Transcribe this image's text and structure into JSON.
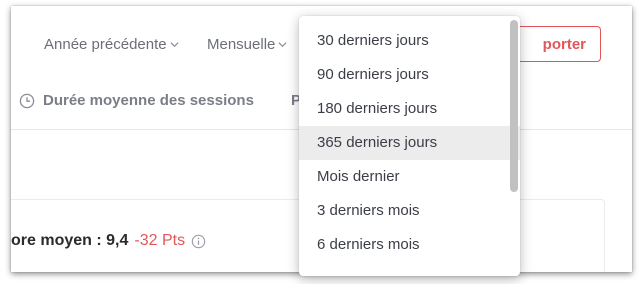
{
  "toolbar": {
    "period_filter": "Année précédente",
    "granularity_filter": "Mensuelle",
    "export_button_label": "porter"
  },
  "metrics_tabs": {
    "session_duration_label": "Durée moyenne des sessions",
    "more_label": "Plu"
  },
  "summary": {
    "score_label": "ore moyen : 9,4",
    "score_delta": "-32 Pts"
  },
  "dropdown": {
    "items": [
      {
        "label": "30 derniers jours",
        "highlighted": false
      },
      {
        "label": "90 derniers jours",
        "highlighted": false
      },
      {
        "label": "180 derniers jours",
        "highlighted": false
      },
      {
        "label": "365 derniers jours",
        "highlighted": true
      },
      {
        "label": "Mois dernier",
        "highlighted": false
      },
      {
        "label": "3 derniers mois",
        "highlighted": false
      },
      {
        "label": "6 derniers mois",
        "highlighted": false
      }
    ]
  },
  "colors": {
    "accent_red": "#e2565a",
    "muted_text": "#6c6f78",
    "highlight_bg": "#ececec"
  },
  "icons": {
    "clock": "clock-icon",
    "chevron": "chevron-down-icon",
    "info": "info-icon"
  }
}
